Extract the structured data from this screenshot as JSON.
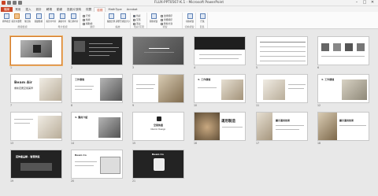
{
  "window": {
    "title": "FLUX-PPT0567-K.1 - Microsoft PowerPoint",
    "controls": [
      "–",
      "□",
      "✕"
    ]
  },
  "tabs": [
    "檔案",
    "常用",
    "插入",
    "設計",
    "轉場",
    "動畫",
    "投影片放映",
    "校閱",
    "檢視",
    "MathType",
    "Acrobat"
  ],
  "active_tab": "檢視",
  "ribbon": {
    "groups": [
      {
        "label": "簡報檢視",
        "buttons": [
          "標準模式",
          "投影片瀏覽",
          "備忘稿",
          "閱讀檢視"
        ]
      },
      {
        "label": "母片檢視",
        "buttons": [
          "投影片母片",
          "講義母片",
          "備忘稿母片"
        ]
      },
      {
        "label": "顯示",
        "checks": [
          "尺規",
          "格線",
          "輔助線"
        ]
      },
      {
        "label": "縮放",
        "buttons": [
          "縮放比例",
          "調整至視窗大小"
        ]
      },
      {
        "label": "色彩/灰階",
        "checks": [
          "色彩",
          "灰階",
          "黑白"
        ]
      },
      {
        "label": "視窗",
        "buttons": [
          "開新視窗"
        ],
        "checks": [
          "並排顯示",
          "重疊顯示",
          "移動分割"
        ]
      },
      {
        "label": "切換視窗",
        "buttons": [
          "切換視窗"
        ]
      },
      {
        "label": "巨集",
        "buttons": [
          "巨集"
        ]
      }
    ]
  },
  "slides": [
    {
      "num": "1",
      "selected": true
    },
    {
      "num": "2"
    },
    {
      "num": "3"
    },
    {
      "num": "4"
    },
    {
      "num": "5"
    },
    {
      "num": "6"
    },
    {
      "num": "7",
      "title": "Beam Air",
      "subtitle": "重新定義空間美學"
    },
    {
      "num": "8",
      "title": "工作環境"
    },
    {
      "num": "9"
    },
    {
      "num": "10",
      "title": "3. 工作環境"
    },
    {
      "num": "11"
    },
    {
      "num": "12",
      "title": "3. 工作環境"
    },
    {
      "num": "13"
    },
    {
      "num": "14",
      "title": "3. 應用介紹"
    },
    {
      "num": "15",
      "title": "空間佈置",
      "subtitle": "Interior Design"
    },
    {
      "num": "16",
      "title": "運用製造"
    },
    {
      "num": "17",
      "title": "顯示運用效果"
    },
    {
      "num": "18",
      "title": "顯示運用效果"
    },
    {
      "num": "19",
      "title": "延伸產品線 - 智慧家庭"
    },
    {
      "num": "20",
      "title": "Beam Co"
    },
    {
      "num": "21",
      "title": "Beam Co"
    }
  ]
}
